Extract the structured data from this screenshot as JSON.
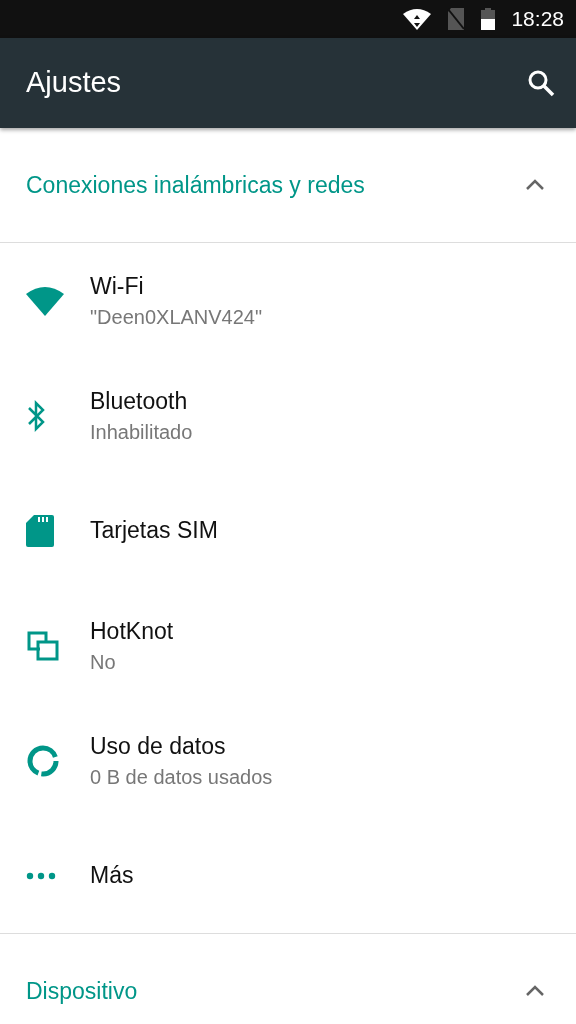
{
  "status_bar": {
    "time": "18:28"
  },
  "app_bar": {
    "title": "Ajustes"
  },
  "sections": [
    {
      "title": "Conexiones inalámbricas y redes",
      "expanded": true,
      "items": [
        {
          "title": "Wi-Fi",
          "summary": "\"Deen0XLANV424\""
        },
        {
          "title": "Bluetooth",
          "summary": "Inhabilitado"
        },
        {
          "title": "Tarjetas SIM"
        },
        {
          "title": "HotKnot",
          "summary": "No"
        },
        {
          "title": "Uso de datos",
          "summary": "0 B de datos usados"
        },
        {
          "title": "Más"
        }
      ]
    },
    {
      "title": "Dispositivo",
      "expanded": true
    }
  ]
}
